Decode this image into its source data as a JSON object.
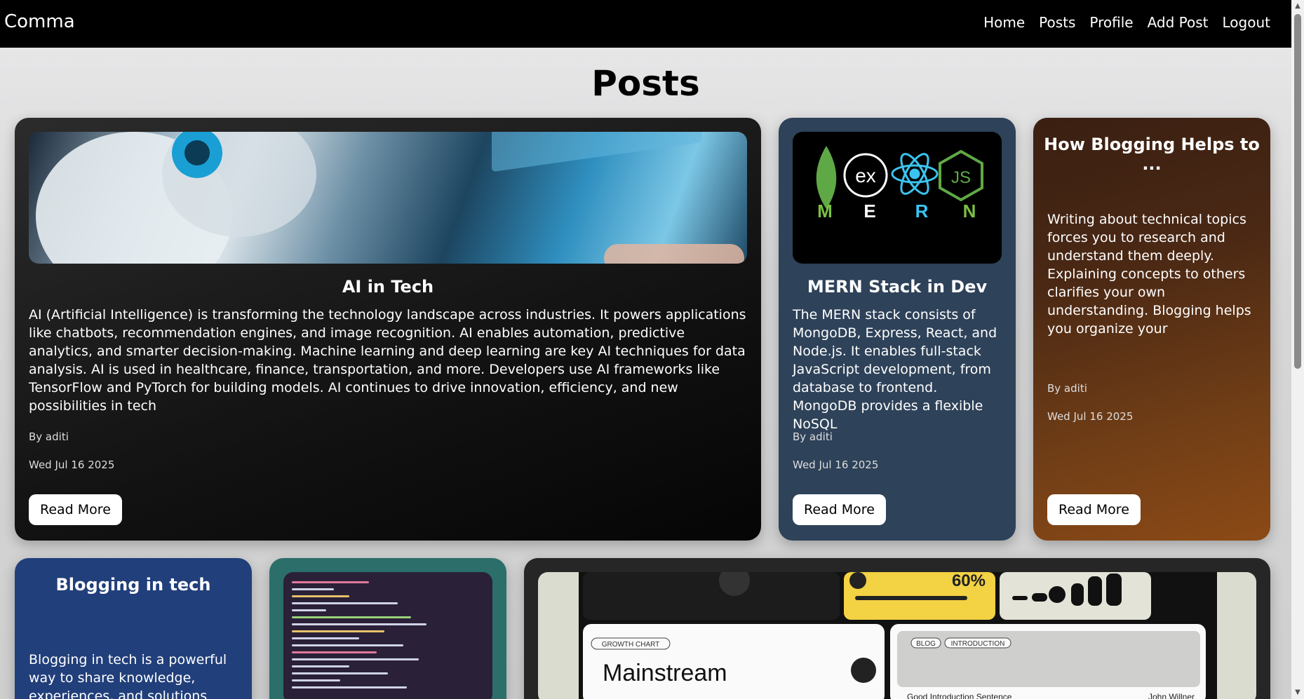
{
  "navbar": {
    "brand": "Comma",
    "links": [
      "Home",
      "Posts",
      "Profile",
      "Add Post",
      "Logout"
    ]
  },
  "page": {
    "title": "Posts"
  },
  "posts": [
    {
      "title": "AI in Tech",
      "text": "AI (Artificial Intelligence) is transforming the technology landscape across industries. It powers applications like chatbots, recommendation engines, and image recognition. AI enables automation, predictive analytics, and smarter decision-making. Machine learning and deep learning are key AI techniques for data analysis. AI is used in healthcare, finance, transportation, and more. Developers use AI frameworks like TensorFlow and PyTorch for building models. AI continues to drive innovation, efficiency, and new possibilities in tech",
      "author": "By aditi",
      "date": "Wed Jul 16 2025",
      "button": "Read More"
    },
    {
      "title": "MERN Stack in Dev",
      "text": "The MERN stack consists of MongoDB, Express, React, and Node.js. It enables full-stack JavaScript development, from database to frontend. MongoDB provides a flexible NoSQL",
      "author": "By aditi",
      "date": "Wed Jul 16 2025",
      "button": "Read More",
      "image_letters": [
        "M",
        "E",
        "R",
        "N"
      ],
      "image_badges": [
        "ex",
        "JS"
      ]
    },
    {
      "title": "How Blogging Helps to ...",
      "text": "Writing about technical topics forces you to research and understand them deeply. Explaining concepts to others clarifies your own understanding. Blogging helps you organize your",
      "author": "By aditi",
      "date": "Wed Jul 16 2025",
      "button": "Read More"
    },
    {
      "title": "Blogging in tech",
      "text": "Blogging in tech is a powerful way to share knowledge, experiences, and solutions with"
    },
    {
      "title": "",
      "image": "code-editor"
    },
    {
      "title": "",
      "image": "dashboard",
      "image_texts": {
        "percent": "60%",
        "chart_tag": "GROWTH CHART",
        "mainstream": "Mainstream",
        "blog_tag": "BLOG",
        "intro_tag": "INTRODUCTION",
        "sentence": "Good Introduction Sentence",
        "author": "John Willner"
      }
    }
  ],
  "colors": {
    "card1": "#121212",
    "card2": "#2e4259",
    "card3": "#6f3d16",
    "card4": "#213f7a",
    "card5": "#2b6e6a",
    "card6": "#262626"
  }
}
